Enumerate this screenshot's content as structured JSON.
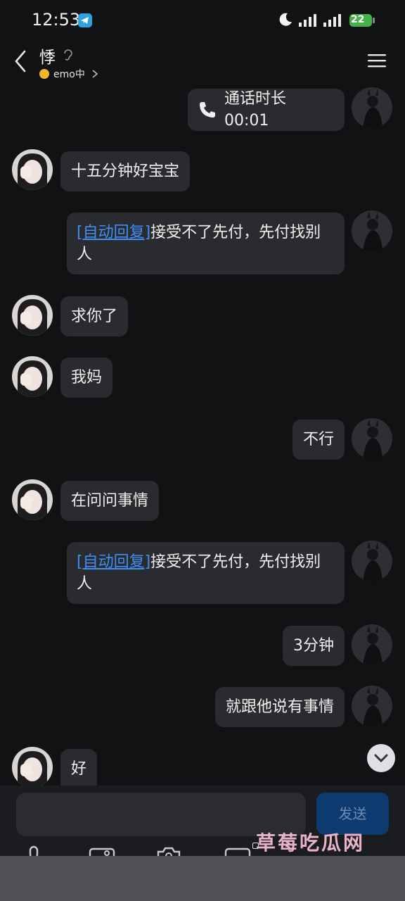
{
  "status_bar": {
    "time": "12:53",
    "battery": "22"
  },
  "header": {
    "contact_name": "悸",
    "status": "emo中"
  },
  "messages": [
    {
      "side": "right",
      "type": "call",
      "text": "通话时长 00:01"
    },
    {
      "side": "left",
      "type": "text",
      "text": "十五分钟好宝宝"
    },
    {
      "side": "right",
      "type": "auto",
      "tag": "[自动回复]",
      "text": "接受不了先付，先付找别人"
    },
    {
      "side": "left",
      "type": "text",
      "text": "求你了"
    },
    {
      "side": "left",
      "type": "text",
      "text": "我妈"
    },
    {
      "side": "right",
      "type": "text",
      "text": "不行"
    },
    {
      "side": "left",
      "type": "text",
      "text": "在问问事情"
    },
    {
      "side": "right",
      "type": "auto",
      "tag": "[自动回复]",
      "text": "接受不了先付，先付找别人"
    },
    {
      "side": "right",
      "type": "text",
      "text": "3分钟"
    },
    {
      "side": "right",
      "type": "text",
      "text": "就跟他说有事情"
    },
    {
      "side": "left",
      "type": "text",
      "text": "好"
    }
  ],
  "composer": {
    "send_label": "发送"
  },
  "watermark": "草莓吃瓜网",
  "colors": {
    "background": "#111214",
    "bubble": "#2a2b2e",
    "auto_reply_link": "#3f8ef5",
    "send_button": "#0d3b70"
  },
  "icons": [
    "back-icon",
    "ear-icon",
    "menu-icon",
    "phone-icon",
    "chevron-down-icon",
    "mic-icon",
    "image-icon",
    "camera-icon",
    "emoji-icon"
  ]
}
